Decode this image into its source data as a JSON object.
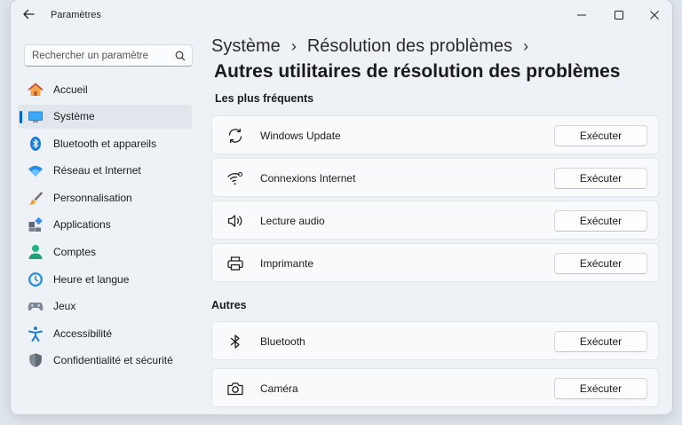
{
  "window": {
    "title": "Paramètres"
  },
  "search": {
    "placeholder": "Rechercher un paramètre"
  },
  "sidebar": {
    "items": [
      {
        "label": "Accueil",
        "icon": "home-icon"
      },
      {
        "label": "Système",
        "icon": "system-icon",
        "active": true
      },
      {
        "label": "Bluetooth et appareils",
        "icon": "bluetooth-icon"
      },
      {
        "label": "Réseau et Internet",
        "icon": "wifi-icon"
      },
      {
        "label": "Personnalisation",
        "icon": "brush-icon"
      },
      {
        "label": "Applications",
        "icon": "apps-icon"
      },
      {
        "label": "Comptes",
        "icon": "account-icon"
      },
      {
        "label": "Heure et langue",
        "icon": "clock-globe-icon"
      },
      {
        "label": "Jeux",
        "icon": "gamepad-icon"
      },
      {
        "label": "Accessibilité",
        "icon": "accessibility-icon"
      },
      {
        "label": "Confidentialité et sécurité",
        "icon": "shield-icon"
      }
    ]
  },
  "breadcrumb": {
    "items": [
      "Système",
      "Résolution des problèmes"
    ]
  },
  "page": {
    "title": "Autres utilitaires de résolution des problèmes"
  },
  "sections": {
    "frequent": {
      "title": "Les plus fréquents",
      "items": [
        {
          "label": "Windows Update",
          "icon": "refresh-icon",
          "button": "Exécuter"
        },
        {
          "label": "Connexions Internet",
          "icon": "wifi-icon",
          "button": "Exécuter"
        },
        {
          "label": "Lecture audio",
          "icon": "speaker-icon",
          "button": "Exécuter"
        },
        {
          "label": "Imprimante",
          "icon": "printer-icon",
          "button": "Exécuter"
        }
      ]
    },
    "other": {
      "title": "Autres",
      "items": [
        {
          "label": "Bluetooth",
          "icon": "bluetooth-icon",
          "button": "Exécuter"
        },
        {
          "label": "Caméra",
          "icon": "camera-icon",
          "button": "Exécuter"
        }
      ]
    }
  },
  "colors": {
    "accent": "#0067c0",
    "window_bg": "#eef2f6",
    "card_bg": "#f9fafb"
  }
}
